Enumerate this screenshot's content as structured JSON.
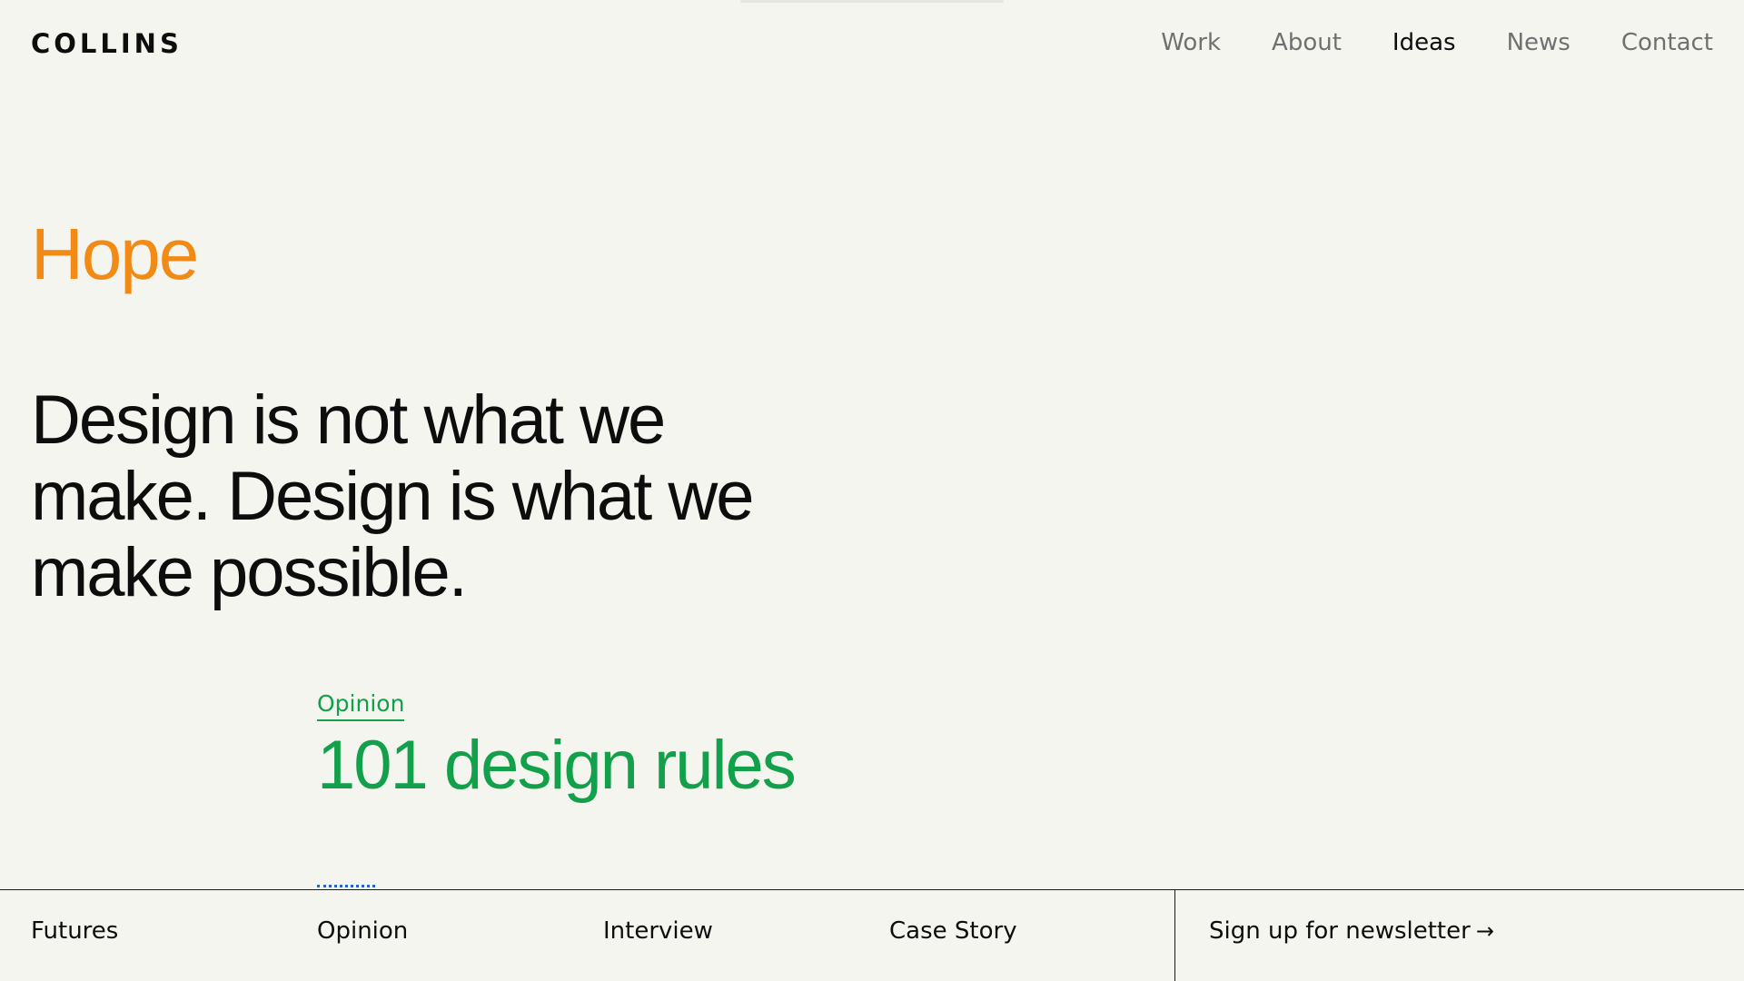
{
  "brand": {
    "logo_text": "COLLINS"
  },
  "nav": {
    "items": [
      {
        "label": "Work"
      },
      {
        "label": "About"
      },
      {
        "label": "Ideas"
      },
      {
        "label": "News"
      },
      {
        "label": "Contact"
      }
    ],
    "active": "Ideas"
  },
  "hero": {
    "category": "Hope",
    "quote": "Design is not what we make. Design is what we make possible."
  },
  "article": {
    "tag": "Opinion",
    "title": "101 design rules"
  },
  "footer_bar": {
    "filters": [
      {
        "label": "Futures"
      },
      {
        "label": "Opinion"
      },
      {
        "label": "Interview"
      },
      {
        "label": "Case Story"
      }
    ],
    "newsletter_label": "Sign up for newsletter",
    "newsletter_arrow": "→"
  },
  "colors": {
    "background": "#f5f5f0",
    "hope_orange": "#f28a16",
    "opinion_green": "#12a04a",
    "text": "#0d0d0d",
    "nav_muted": "#707070"
  },
  "icons": {
    "newsletter_arrow": "arrow-right-icon"
  }
}
